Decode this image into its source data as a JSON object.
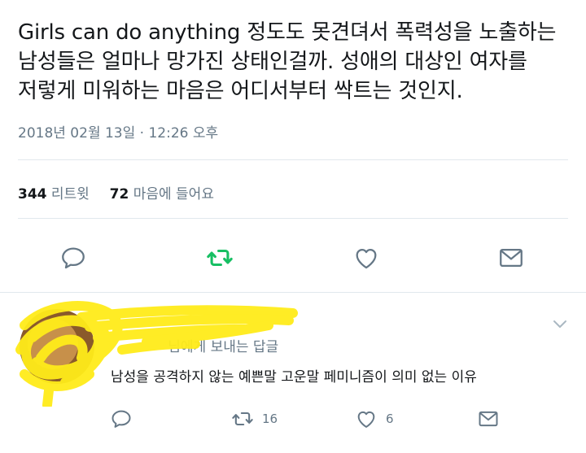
{
  "tweet": {
    "text_lines": [
      "Girls can do anything 정도도 못견뎌서 폭력성을 노출하는",
      "남성들은 얼마나 망가진 상태인걸까. 성애의 대상인 여자를",
      "저렇게 미워하는 마음은 어디서부터 싹트는 것인지."
    ],
    "timestamp": "2018년 02월 13일 · 12:26 오후",
    "retweet_count": "344",
    "retweet_label": "리트윗",
    "like_count": "72",
    "like_label": "마음에 들어요"
  },
  "actions": {
    "reply_icon": "reply-icon",
    "retweet_icon": "retweet-icon",
    "like_icon": "heart-icon",
    "dm_icon": "envelope-icon",
    "retweet_color": "#17bf63",
    "icon_color": "#657786"
  },
  "reply": {
    "name": "",
    "handle_line_suffix": "님에게 보내는 답글",
    "text": "남성을 공격하지 않는 예쁜말 고운말 페미니즘이 의미 없는 이유",
    "retweets": "16",
    "likes": "6"
  },
  "colors": {
    "link": "#1da1f2",
    "muted": "#657786",
    "divider": "#e1e8ed",
    "redaction": "#ffec1a"
  }
}
